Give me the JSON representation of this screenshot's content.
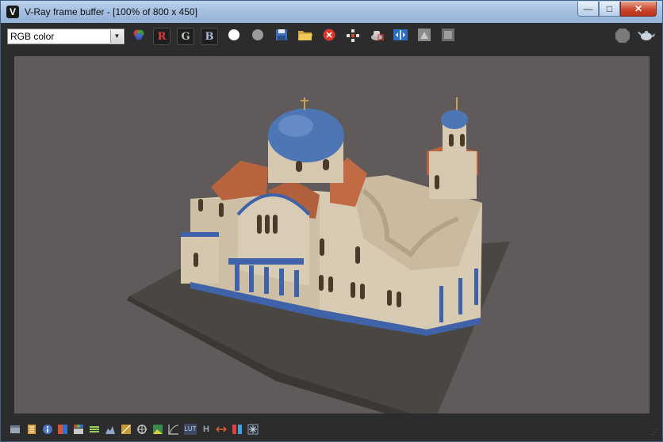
{
  "window": {
    "title": "V-Ray frame buffer - [100% of 800 x 450]",
    "app_icon_glyph": "V",
    "minimize_glyph": "—",
    "maximize_glyph": "□",
    "close_glyph": "✕"
  },
  "toolbar": {
    "channel_select": {
      "value": "RGB color",
      "arrow": "▼"
    },
    "channel_r": "R",
    "channel_g": "G",
    "channel_b": "B",
    "icons": [
      "color-channels-icon",
      "red-channel-icon",
      "green-channel-icon",
      "blue-channel-icon",
      "white-circle-icon",
      "gray-circle-icon",
      "save-image-icon",
      "open-image-icon",
      "clear-image-icon",
      "track-mouse-icon",
      "render-region-icon",
      "compare-ab-icon",
      "histogram-icon",
      "stamp-icon",
      "stop-render-icon",
      "teapot-render-icon"
    ]
  },
  "statusbar": {
    "icons": [
      "frame-icon",
      "history-icon",
      "info-icon",
      "color-correction-icon",
      "pixel-info-icon",
      "levels-icon",
      "exposure-icon",
      "curve-icon",
      "stamp-icon",
      "lens-effects-icon",
      "image-icon",
      "curves-graph-icon",
      "lut-icon",
      "h-icon",
      "stretch-icon",
      "split-icon",
      "snowflake-icon"
    ],
    "lut_label": "LUT",
    "h_label": "H",
    "grip": "⋰"
  },
  "colors": {
    "titlebar": "#a5c0e0",
    "toolbar_bg": "#2c2c2c",
    "canvas_bg": "#605b5a",
    "wall": "#d8cbb4",
    "dome": "#4d76b5",
    "roof": "#b8643f",
    "trim": "#3f62a8"
  }
}
